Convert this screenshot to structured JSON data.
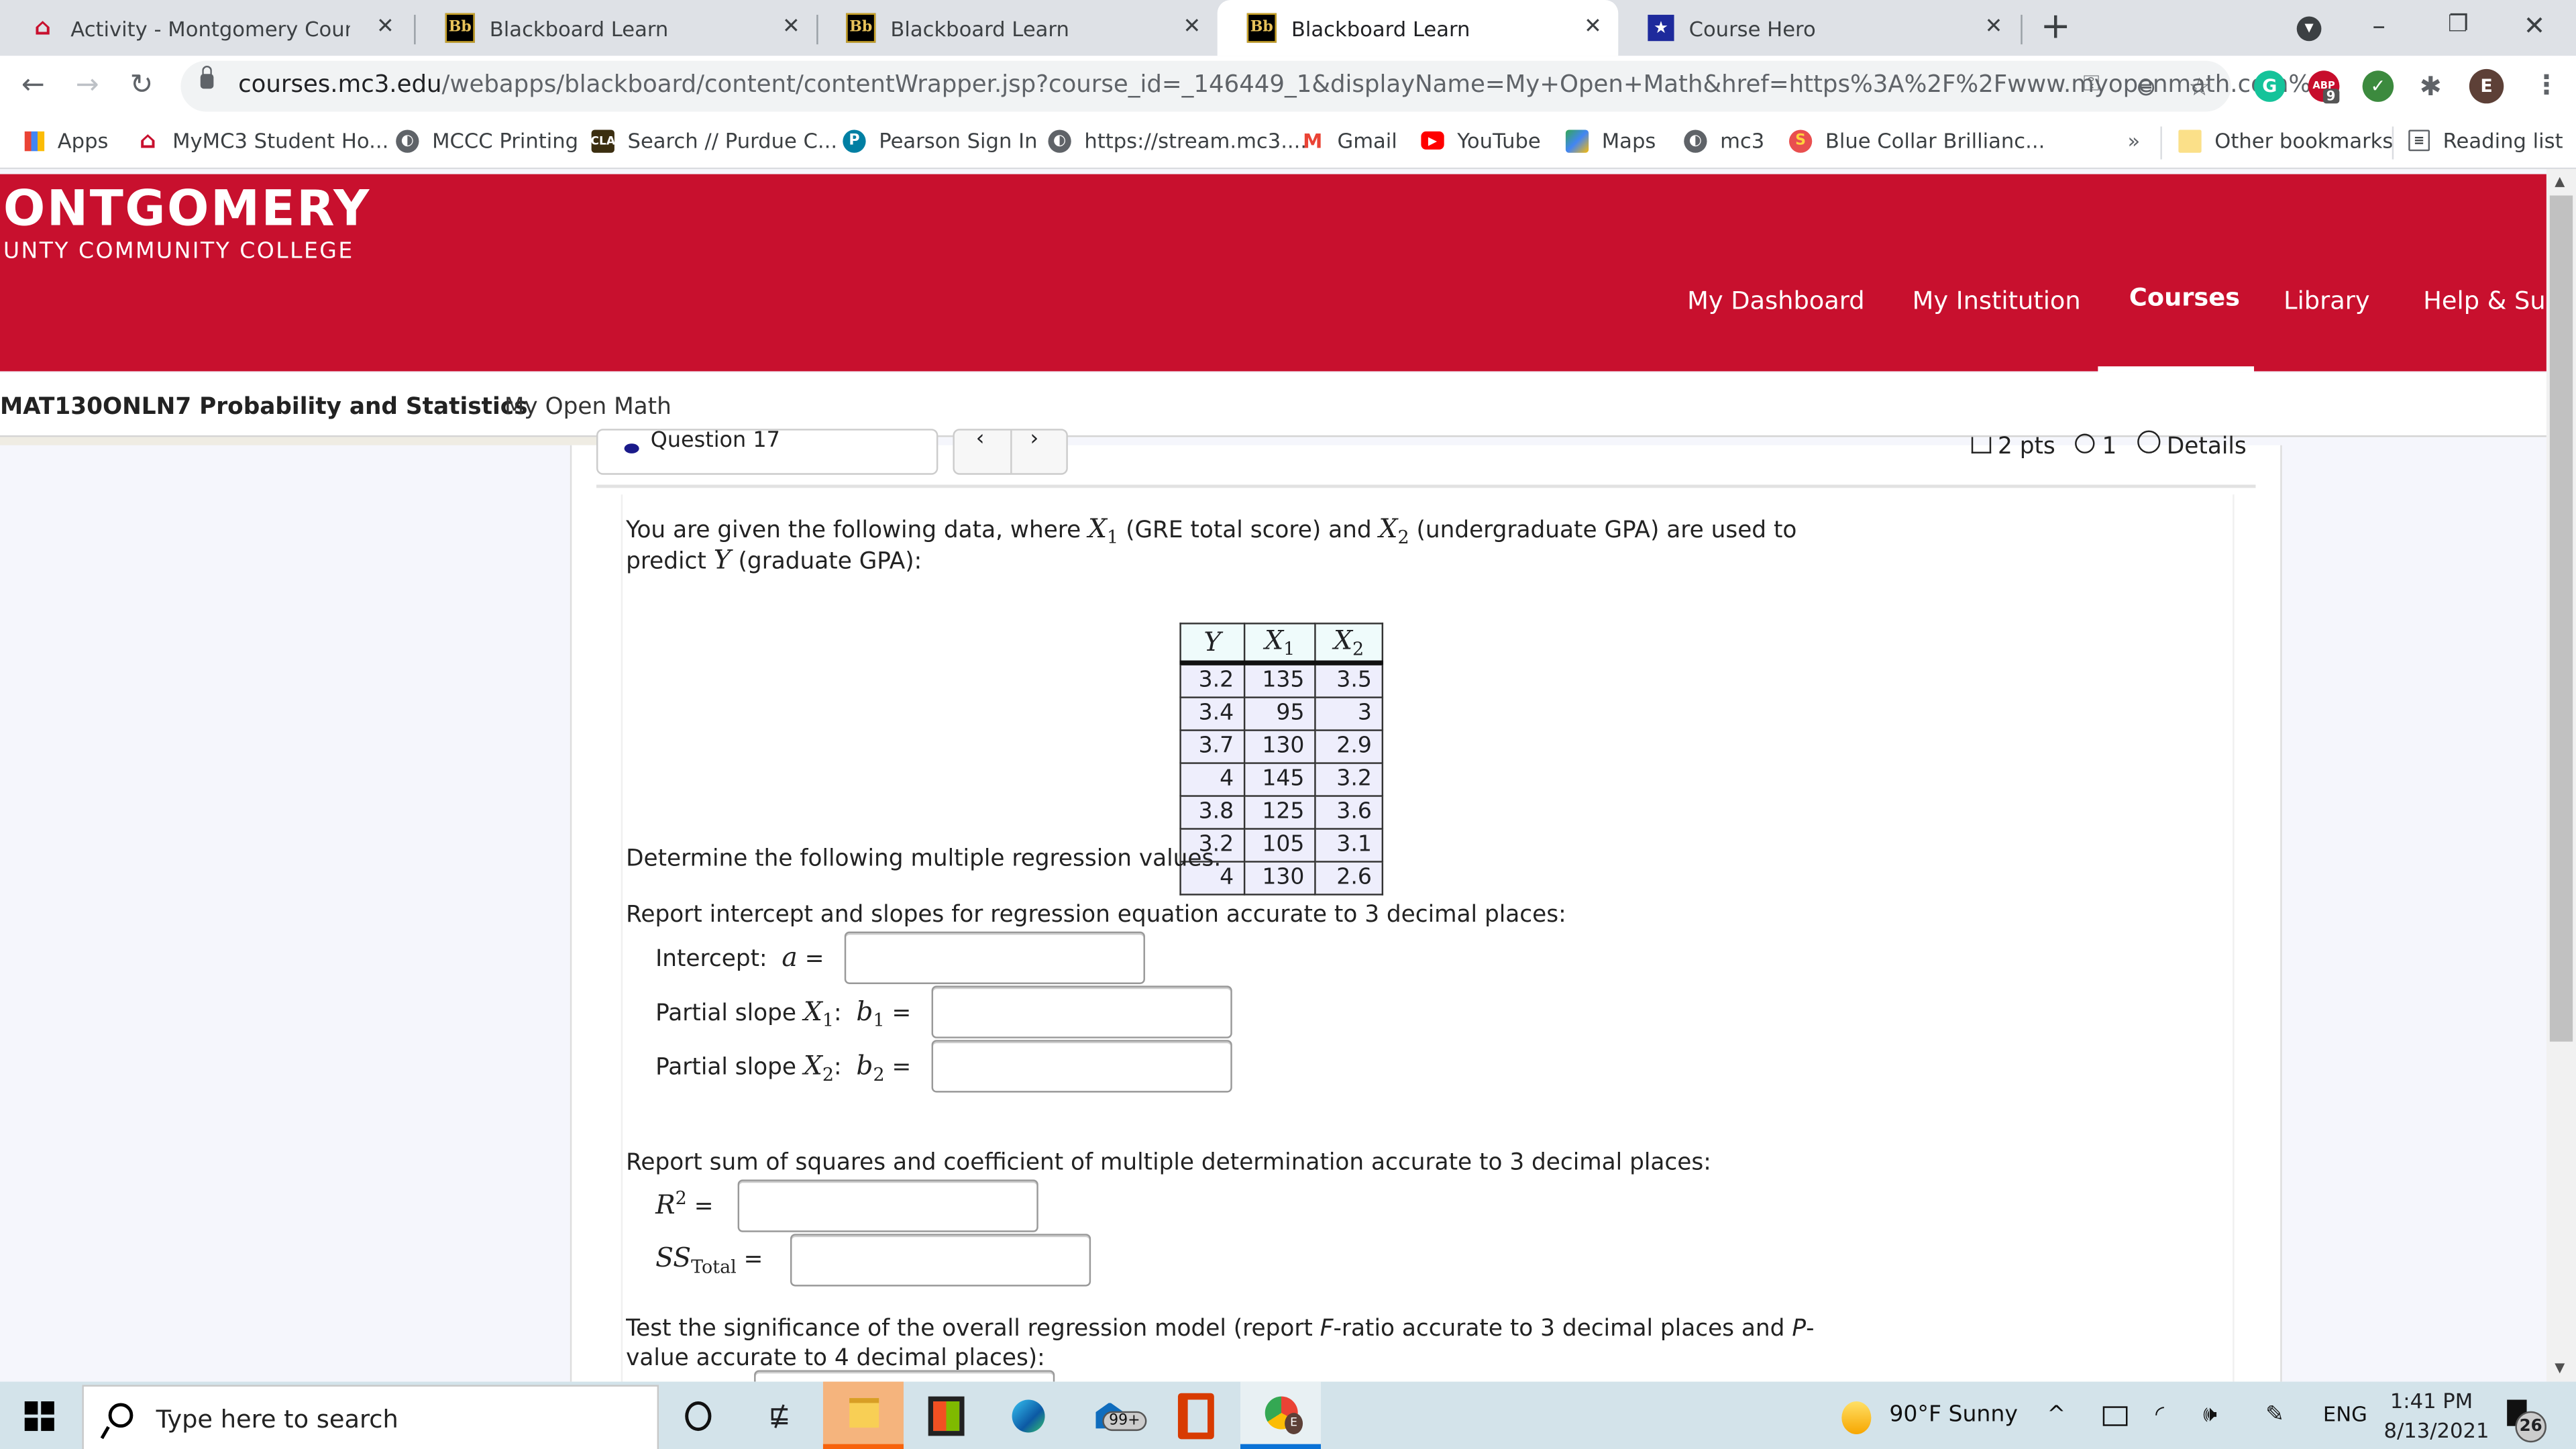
{
  "browser": {
    "tabs": [
      {
        "title": "Activity - Montgomery County Co",
        "icon": "mc3-home-icon",
        "active": false
      },
      {
        "title": "Blackboard Learn",
        "icon": "blackboard-icon",
        "active": false
      },
      {
        "title": "Blackboard Learn",
        "icon": "blackboard-icon",
        "active": false
      },
      {
        "title": "Blackboard Learn",
        "icon": "blackboard-icon",
        "active": true
      },
      {
        "title": "Course Hero",
        "icon": "course-hero-icon",
        "active": false
      }
    ],
    "new_tab": "+",
    "window_controls": {
      "minimize": "–",
      "restore": "❐",
      "close": "✕"
    },
    "url": {
      "host": "courses.mc3.edu",
      "path": "/webapps/blackboard/content/contentWrapper.jsp?course_id=_146449_1&displayName=My+Open+Math&href=https%3A%2F%2Fwww.myopenmath.com%..."
    },
    "extensions": [
      {
        "name": "grammarly",
        "label": "G",
        "color": "#15c39a"
      },
      {
        "name": "adblock",
        "label": "ABP",
        "badge": "9",
        "color": "#c70d2c"
      },
      {
        "name": "checkmark",
        "label": "✓",
        "color": "#3c8a3e"
      },
      {
        "name": "extensions",
        "label": "✱",
        "color": "#5f6368"
      },
      {
        "name": "profile",
        "label": "E",
        "color": "#5d4037"
      }
    ],
    "bookmarks": [
      {
        "label": "Apps",
        "icon": "apps-grid-icon"
      },
      {
        "label": "MyMC3 Student Ho...",
        "icon": "mc3-home-icon"
      },
      {
        "label": "MCCC Printing",
        "icon": "globe-icon"
      },
      {
        "label": "Search // Purdue C...",
        "icon": "cla-icon"
      },
      {
        "label": "Pearson Sign In",
        "icon": "pearson-icon"
      },
      {
        "label": "https://stream.mc3....",
        "icon": "globe-icon"
      },
      {
        "label": "Gmail",
        "icon": "gmail-icon"
      },
      {
        "label": "YouTube",
        "icon": "youtube-icon"
      },
      {
        "label": "Maps",
        "icon": "maps-icon"
      },
      {
        "label": "mc3",
        "icon": "globe-icon"
      },
      {
        "label": "Blue Collar Brillianc...",
        "icon": "s-icon"
      }
    ],
    "bookmarks_overflow": "»",
    "other_bookmarks": "Other bookmarks",
    "reading_list": "Reading list"
  },
  "site": {
    "logo_line1": "ONTGOMERY",
    "logo_line2": "UNTY COMMUNITY COLLEGE",
    "brand_color": "#c8102e",
    "nav": [
      {
        "label": "My Dashboard",
        "active": false
      },
      {
        "label": "My Institution",
        "active": false
      },
      {
        "label": "Courses",
        "active": true
      },
      {
        "label": "Library",
        "active": false
      },
      {
        "label": "Help & Sup",
        "active": false
      }
    ],
    "course_name": "MAT130ONLN7 Probability and Statistics",
    "content_name": "My Open Math"
  },
  "question": {
    "selector_label": "Question 17",
    "nav_prev": "‹",
    "nav_next": "›",
    "points": "2 pts",
    "attempts": "1",
    "details": "Details",
    "intro_part1": "You are given the following data, where ",
    "x1": "X",
    "sub1": "1",
    "intro_part2": " (GRE total score) and ",
    "x2": "X",
    "sub2": "2",
    "intro_part3": " (undergraduate GPA) are used to",
    "intro_line2a": "predict ",
    "y": "Y",
    "intro_line2b": " (graduate GPA):",
    "table": {
      "headers": [
        {
          "v": "Y",
          "sub": ""
        },
        {
          "v": "X",
          "sub": "1"
        },
        {
          "v": "X",
          "sub": "2"
        }
      ],
      "rows": [
        [
          "3.2",
          "135",
          "3.5"
        ],
        [
          "3.4",
          "95",
          "3"
        ],
        [
          "3.7",
          "130",
          "2.9"
        ],
        [
          "4",
          "145",
          "3.2"
        ],
        [
          "3.8",
          "125",
          "3.6"
        ],
        [
          "3.2",
          "105",
          "3.1"
        ],
        [
          "4",
          "130",
          "2.6"
        ]
      ]
    },
    "determine": "Determine the following multiple regression values.",
    "section1": "Report intercept and slopes for regression equation accurate to 3 decimal places:",
    "intercept_label": "Intercept:",
    "intercept_var": "a",
    "slope1_label": "Partial slope ",
    "slope1_var": "b",
    "slope2_label": "Partial slope ",
    "slope2_var": "b",
    "equals": "=",
    "colon": ":",
    "section2": "Report sum of squares and coefficient of multiple determination accurate to 3 decimal places:",
    "r2_var": "R",
    "r2_sup": "2",
    "ss_var": "SS",
    "ss_sub": "Total",
    "section3_line1a": "Test the significance of the overall regression model (report ",
    "section3_f": "F",
    "section3_line1b": "-ratio accurate to 3 decimal places and ",
    "section3_p": "P",
    "section3_line1c": "-",
    "section3_line2": "value accurate to 4 decimal places):",
    "inputs": {
      "intercept": "",
      "b1": "",
      "b2": "",
      "r2": "",
      "ss_total": "",
      "f_ratio": ""
    }
  },
  "taskbar": {
    "search_placeholder": "Type here to search",
    "mail_badge": "99+",
    "weather": "90°F  Sunny",
    "language": "ENG",
    "time": "1:41 PM",
    "date": "8/13/2021",
    "notifications": "26"
  }
}
